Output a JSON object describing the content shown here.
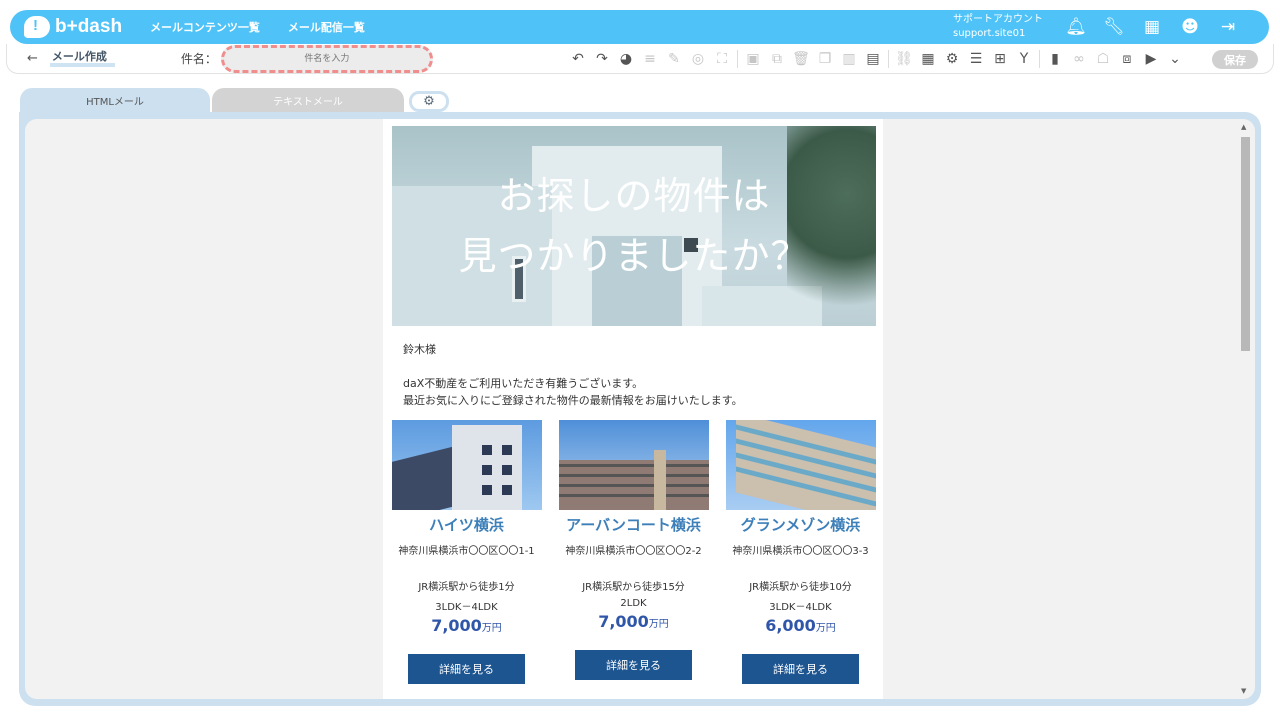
{
  "header": {
    "logo": "b+dash",
    "nav": [
      "メールコンテンツ一覧",
      "メール配信一覧"
    ],
    "account_name": "サポートアカウント",
    "account_id": "support.site01",
    "icons": [
      "bell-icon",
      "wrench-icon",
      "apps-grid-icon",
      "face-icon",
      "logout-icon"
    ],
    "accent": "#4fc3f7"
  },
  "toolbar": {
    "back_arrow": "←",
    "title": "メール作成",
    "subject_label": "件名：",
    "subject_placeholder": "件名を入力",
    "save_label": "保存",
    "tools": [
      {
        "name": "undo-icon",
        "glyph": "↶",
        "dim": false
      },
      {
        "name": "redo-icon",
        "glyph": "↷",
        "dim": false
      },
      {
        "name": "palette-icon",
        "glyph": "◕",
        "dim": false
      },
      {
        "name": "align-icon",
        "glyph": "≡",
        "dim": true
      },
      {
        "name": "pen-icon",
        "glyph": "✎",
        "dim": true
      },
      {
        "name": "target-icon",
        "glyph": "◎",
        "dim": true
      },
      {
        "name": "fullscreen-icon",
        "glyph": "⛶",
        "dim": true
      },
      {
        "name": "image-icon",
        "glyph": "▣",
        "dim": true
      },
      {
        "name": "copy-icon",
        "glyph": "⧉",
        "dim": true
      },
      {
        "name": "trash-icon",
        "glyph": "🗑",
        "dim": true
      },
      {
        "name": "duplicate-icon",
        "glyph": "❐",
        "dim": true
      },
      {
        "name": "columns-icon",
        "glyph": "▥",
        "dim": true
      },
      {
        "name": "rows-icon",
        "glyph": "▤",
        "dim": false
      },
      {
        "name": "link-icon",
        "glyph": "⛓",
        "dim": true
      },
      {
        "name": "calendar-icon",
        "glyph": "▦",
        "dim": false
      },
      {
        "name": "gears-icon",
        "glyph": "⚙",
        "dim": false
      },
      {
        "name": "database-icon",
        "glyph": "☰",
        "dim": false
      },
      {
        "name": "add-block-icon",
        "glyph": "⊞",
        "dim": false
      },
      {
        "name": "branch-icon",
        "glyph": "Y",
        "dim": false
      },
      {
        "name": "blocks-icon",
        "glyph": "▮",
        "dim": false
      },
      {
        "name": "chain-icon",
        "glyph": "∞",
        "dim": true
      },
      {
        "name": "contact-icon",
        "glyph": "☖",
        "dim": true
      },
      {
        "name": "layers-icon",
        "glyph": "⧈",
        "dim": false
      },
      {
        "name": "play-icon",
        "glyph": "▶",
        "dim": false
      },
      {
        "name": "chevron-down-icon",
        "glyph": "⌄",
        "dim": false
      }
    ]
  },
  "tabs": {
    "html": "HTMLメール",
    "text": "テキストメール",
    "settings_icon": "gear-icon"
  },
  "mail": {
    "hero_line1": "お探しの物件は",
    "hero_line2": "見つかりましたか？",
    "greeting": "鈴木様",
    "body_line1": "daX不動産をご利用いただき有難うございます。",
    "body_line2": "最近お気に入りにご登録された物件の最新情報をお届けいたします。",
    "properties": [
      {
        "name": "ハイツ横浜",
        "address": "神奈川県横浜市〇〇区〇〇1-1",
        "station": "JR横浜駅から徒歩1分",
        "layout": "3LDK－4LDK",
        "price": "7,000",
        "unit": "万円",
        "button": "詳細を見る"
      },
      {
        "name": "アーバンコート横浜",
        "address": "神奈川県横浜市〇〇区〇〇2-2",
        "station": "JR横浜駅から徒歩15分",
        "layout": "2LDK",
        "price": "7,000",
        "unit": "万円",
        "button": "詳細を見る"
      },
      {
        "name": "グランメゾン横浜",
        "address": "神奈川県横浜市〇〇区〇〇3-3",
        "station": "JR横浜駅から徒歩10分",
        "layout": "3LDK－4LDK",
        "price": "6,000",
        "unit": "万円",
        "button": "詳細を見る"
      }
    ]
  }
}
